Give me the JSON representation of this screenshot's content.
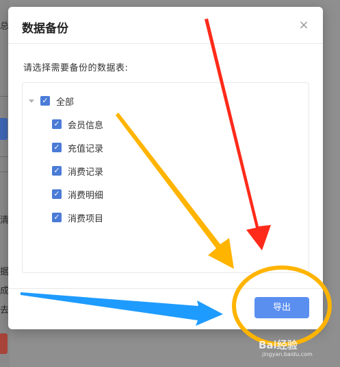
{
  "background": {
    "fragments": [
      "总析",
      "清",
      "据",
      "成",
      "去"
    ]
  },
  "dialog": {
    "title": "数据备份",
    "close_glyph": "×",
    "prompt": "请选择需要备份的数据表:",
    "tree": {
      "root": {
        "label": "全部",
        "checked": true,
        "expanded": true
      },
      "items": [
        {
          "label": "会员信息",
          "checked": true
        },
        {
          "label": "充值记录",
          "checked": true
        },
        {
          "label": "消费记录",
          "checked": true
        },
        {
          "label": "消费明细",
          "checked": true
        },
        {
          "label": "消费项目",
          "checked": true
        }
      ]
    },
    "export_label": "导出"
  },
  "colors": {
    "accent": "#5a8ff0",
    "checkbox": "#4a7bd6",
    "arrow_red": "#ff2a1a",
    "arrow_orange": "#ffb400",
    "arrow_blue": "#1e9bff",
    "highlight_circle": "#ffb400"
  },
  "watermark": {
    "text": "Bai经验",
    "sub": "jingyan.baidu.com"
  }
}
